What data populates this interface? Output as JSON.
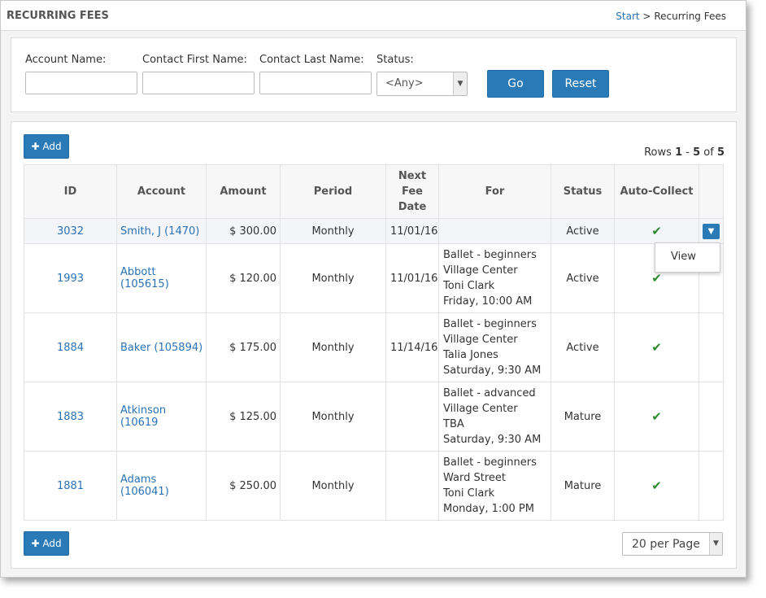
{
  "header": {
    "title": "RECURRING FEES",
    "breadcrumb": {
      "start": "Start",
      "separator": ">",
      "current": "Recurring Fees"
    }
  },
  "filters": {
    "account_name_label": "Account Name:",
    "contact_first_label": "Contact First Name:",
    "contact_last_label": "Contact Last Name:",
    "status_label": "Status:",
    "status_value": "<Any>",
    "go_label": "Go",
    "reset_label": "Reset"
  },
  "toolbar": {
    "add_label": "Add"
  },
  "rows_info": {
    "prefix": "Rows",
    "from": "1",
    "dash": "-",
    "to": "5",
    "of": "of",
    "total": "5"
  },
  "table": {
    "columns": {
      "id": "ID",
      "account": "Account",
      "amount": "Amount",
      "period": "Period",
      "next_line1": "Next",
      "next_line2": "Fee",
      "next_line3": "Date",
      "for": "For",
      "status": "Status",
      "auto_collect": "Auto-Collect"
    },
    "rows": [
      {
        "id": "3032",
        "account": "Smith, J (1470)",
        "amount": "$ 300.00",
        "period": "Monthly",
        "next_date": "11/01/16",
        "for": [
          "",
          "",
          "",
          ""
        ],
        "status": "Active",
        "auto_collect": "✔"
      },
      {
        "id": "1993",
        "account": "Abbott (105615)",
        "amount": "$ 120.00",
        "period": "Monthly",
        "next_date": "11/01/16",
        "for": [
          "Ballet - beginners",
          "Village Center",
          "Toni Clark",
          "Friday, 10:00 AM"
        ],
        "status": "Active",
        "auto_collect": "✔"
      },
      {
        "id": "1884",
        "account": "Baker (105894)",
        "amount": "$ 175.00",
        "period": "Monthly",
        "next_date": "11/14/16",
        "for": [
          "Ballet - beginners",
          "Village Center",
          "Talia Jones",
          "Saturday, 9:30 AM"
        ],
        "status": "Active",
        "auto_collect": "✔"
      },
      {
        "id": "1883",
        "account": "Atkinson (10619",
        "amount": "$ 125.00",
        "period": "Monthly",
        "next_date": "",
        "for": [
          "Ballet - advanced",
          "Village Center",
          "TBA",
          "Saturday, 9:30 AM"
        ],
        "status": "Mature",
        "auto_collect": "✔"
      },
      {
        "id": "1881",
        "account": "Adams (106041)",
        "amount": "$ 250.00",
        "period": "Monthly",
        "next_date": "",
        "for": [
          "Ballet - beginners",
          "Ward Street",
          "Toni Clark",
          "Monday, 1:00 PM"
        ],
        "status": "Mature",
        "auto_collect": "✔"
      }
    ]
  },
  "row_menu": {
    "view_label": "View"
  },
  "pagination": {
    "per_page_value": "20 per Page"
  },
  "icons": {
    "add": "plus-icon",
    "dropdown": "chevron-down-icon",
    "check": "check-icon"
  },
  "colors": {
    "primary": "#2a7ab8",
    "link": "#2a72b5",
    "check": "#2e8b2e"
  }
}
